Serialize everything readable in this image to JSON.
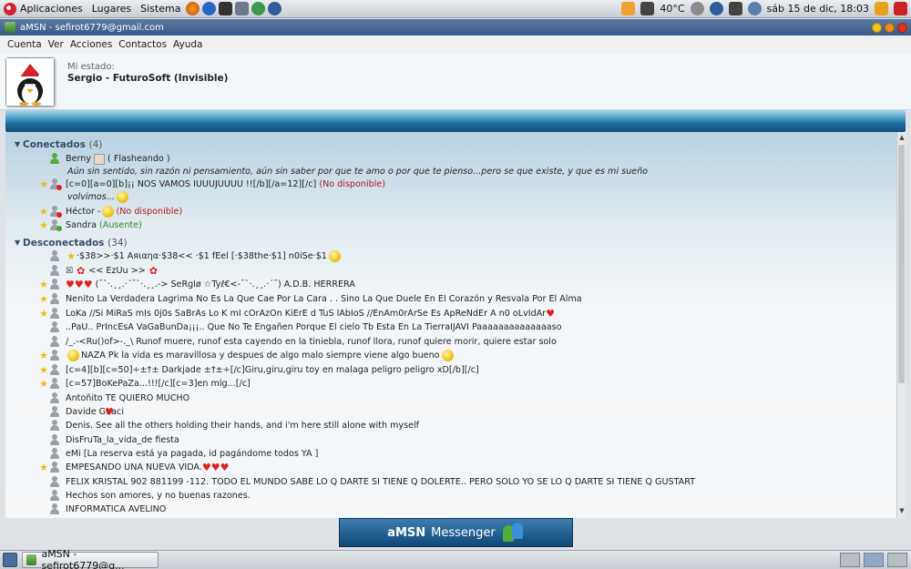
{
  "top_panel": {
    "menus": [
      "Aplicaciones",
      "Lugares",
      "Sistema"
    ],
    "temperature": "40°C",
    "clock": "sáb 15 de dic, 18:03"
  },
  "window": {
    "title": "aMSN - sefirot6779@gmail.com"
  },
  "menubar": {
    "items": [
      "Cuenta",
      "Ver",
      "Acciones",
      "Contactos",
      "Ayuda"
    ]
  },
  "header": {
    "status_label": "Mi estado:",
    "nick": "Sergio - FuturoSoft (Invisible)"
  },
  "groups": {
    "online": {
      "name": "Conectados",
      "count": "(4)"
    },
    "offline": {
      "name": "Desconectados",
      "count": "(34)"
    }
  },
  "online_contacts": [
    {
      "name": "Berny",
      "extra": "( Flasheando )",
      "psm": "Aún sin sentido, sin razón ni pensamiento, aún sin saber por que te amo o por que te pienso...pero se que existe, y que es mi sueño"
    },
    {
      "name": "[c=0][a=0][b]¡¡ NOS VAMOS IUUUJUUUU !![/b][/a=12][/c]",
      "status": "(No disponible)",
      "psm": "volvimos..."
    },
    {
      "name": "Héctor -",
      "status": "(No disponible)"
    },
    {
      "name": "Sandra",
      "status": "(Ausente)"
    }
  ],
  "offline_contacts": [
    "·$38>>·$1 Aяιαηα·$38<< ·$1 fEel [·$38the·$1] n0iSe·$1",
    "<< EzUu >>",
    "(¯`·.¸¸.·´¯`·.¸¸.-> SeRglø ☆Tyℓ€<-¯`·.¸¸.·´¯) A.D.B. HERRERA",
    "Nenito La Verdadera Lagrima No Es La Que Cae Por La Cara . .  Sino La Que Duele En El Corazón y Resvala Por El Alma",
    "LoKa //Si MiRaS mIs 0j0s SaBrAs Lo K mI cOrAzOn KiErE d TuS lAbIoS //EnAm0rArSe Es ApReNdEr A n0 oLvIdAr",
    "..PaU..  PrIncEsA VaGaBunDa¡¡¡.. Que No Te Engañen Porque El cielo Tb Esta En La TierraIJAVI Paaaaaaaaaaaaaaso",
    "/_.-<Ru()of>-._\\  Runof muere, runof esta cayendo en la tiniebla, runof llora, runof quiere morir, quiere estar solo",
    "NAZA Pk la vida es maravillosa y despues de algo malo siempre viene algo bueno",
    "[c=4][b][c=50]÷±†± Darkjade ±†±÷[/c]Giru,giru,giru toy en malaga peligro peligro xD[/b][/c]",
    "[c=57]BoKePaZa...!!![/c][c=3]en mlg...[/c]",
    "Antoñito TE QUIERO MUCHO",
    "Davide  Guaci",
    "Denis. See all the others holding their hands, and i'm here still alone with myself",
    "DisFruTa_la_vida_de fiesta",
    "eMi [La reserva está ya pagada, id pagándome todos YA  ]",
    "EMPESANDO UNA NUEVA VIDA.",
    "FELIX KRISTAL 902 881199 -112. TODO EL MUNDO SABE LO Q DARTE SI TIENE Q DOLERTE.. PERO SOLO YO SE LO Q DARTE SI TIENE Q GUSTART",
    "Hechos son amores, y no buenas razones.",
    "INFORMATICA AVELINO"
  ],
  "banner": {
    "brand": "aMSN",
    "product": "Messenger"
  },
  "taskbar": {
    "task_label": "aMSN - sefirot6779@g..."
  }
}
